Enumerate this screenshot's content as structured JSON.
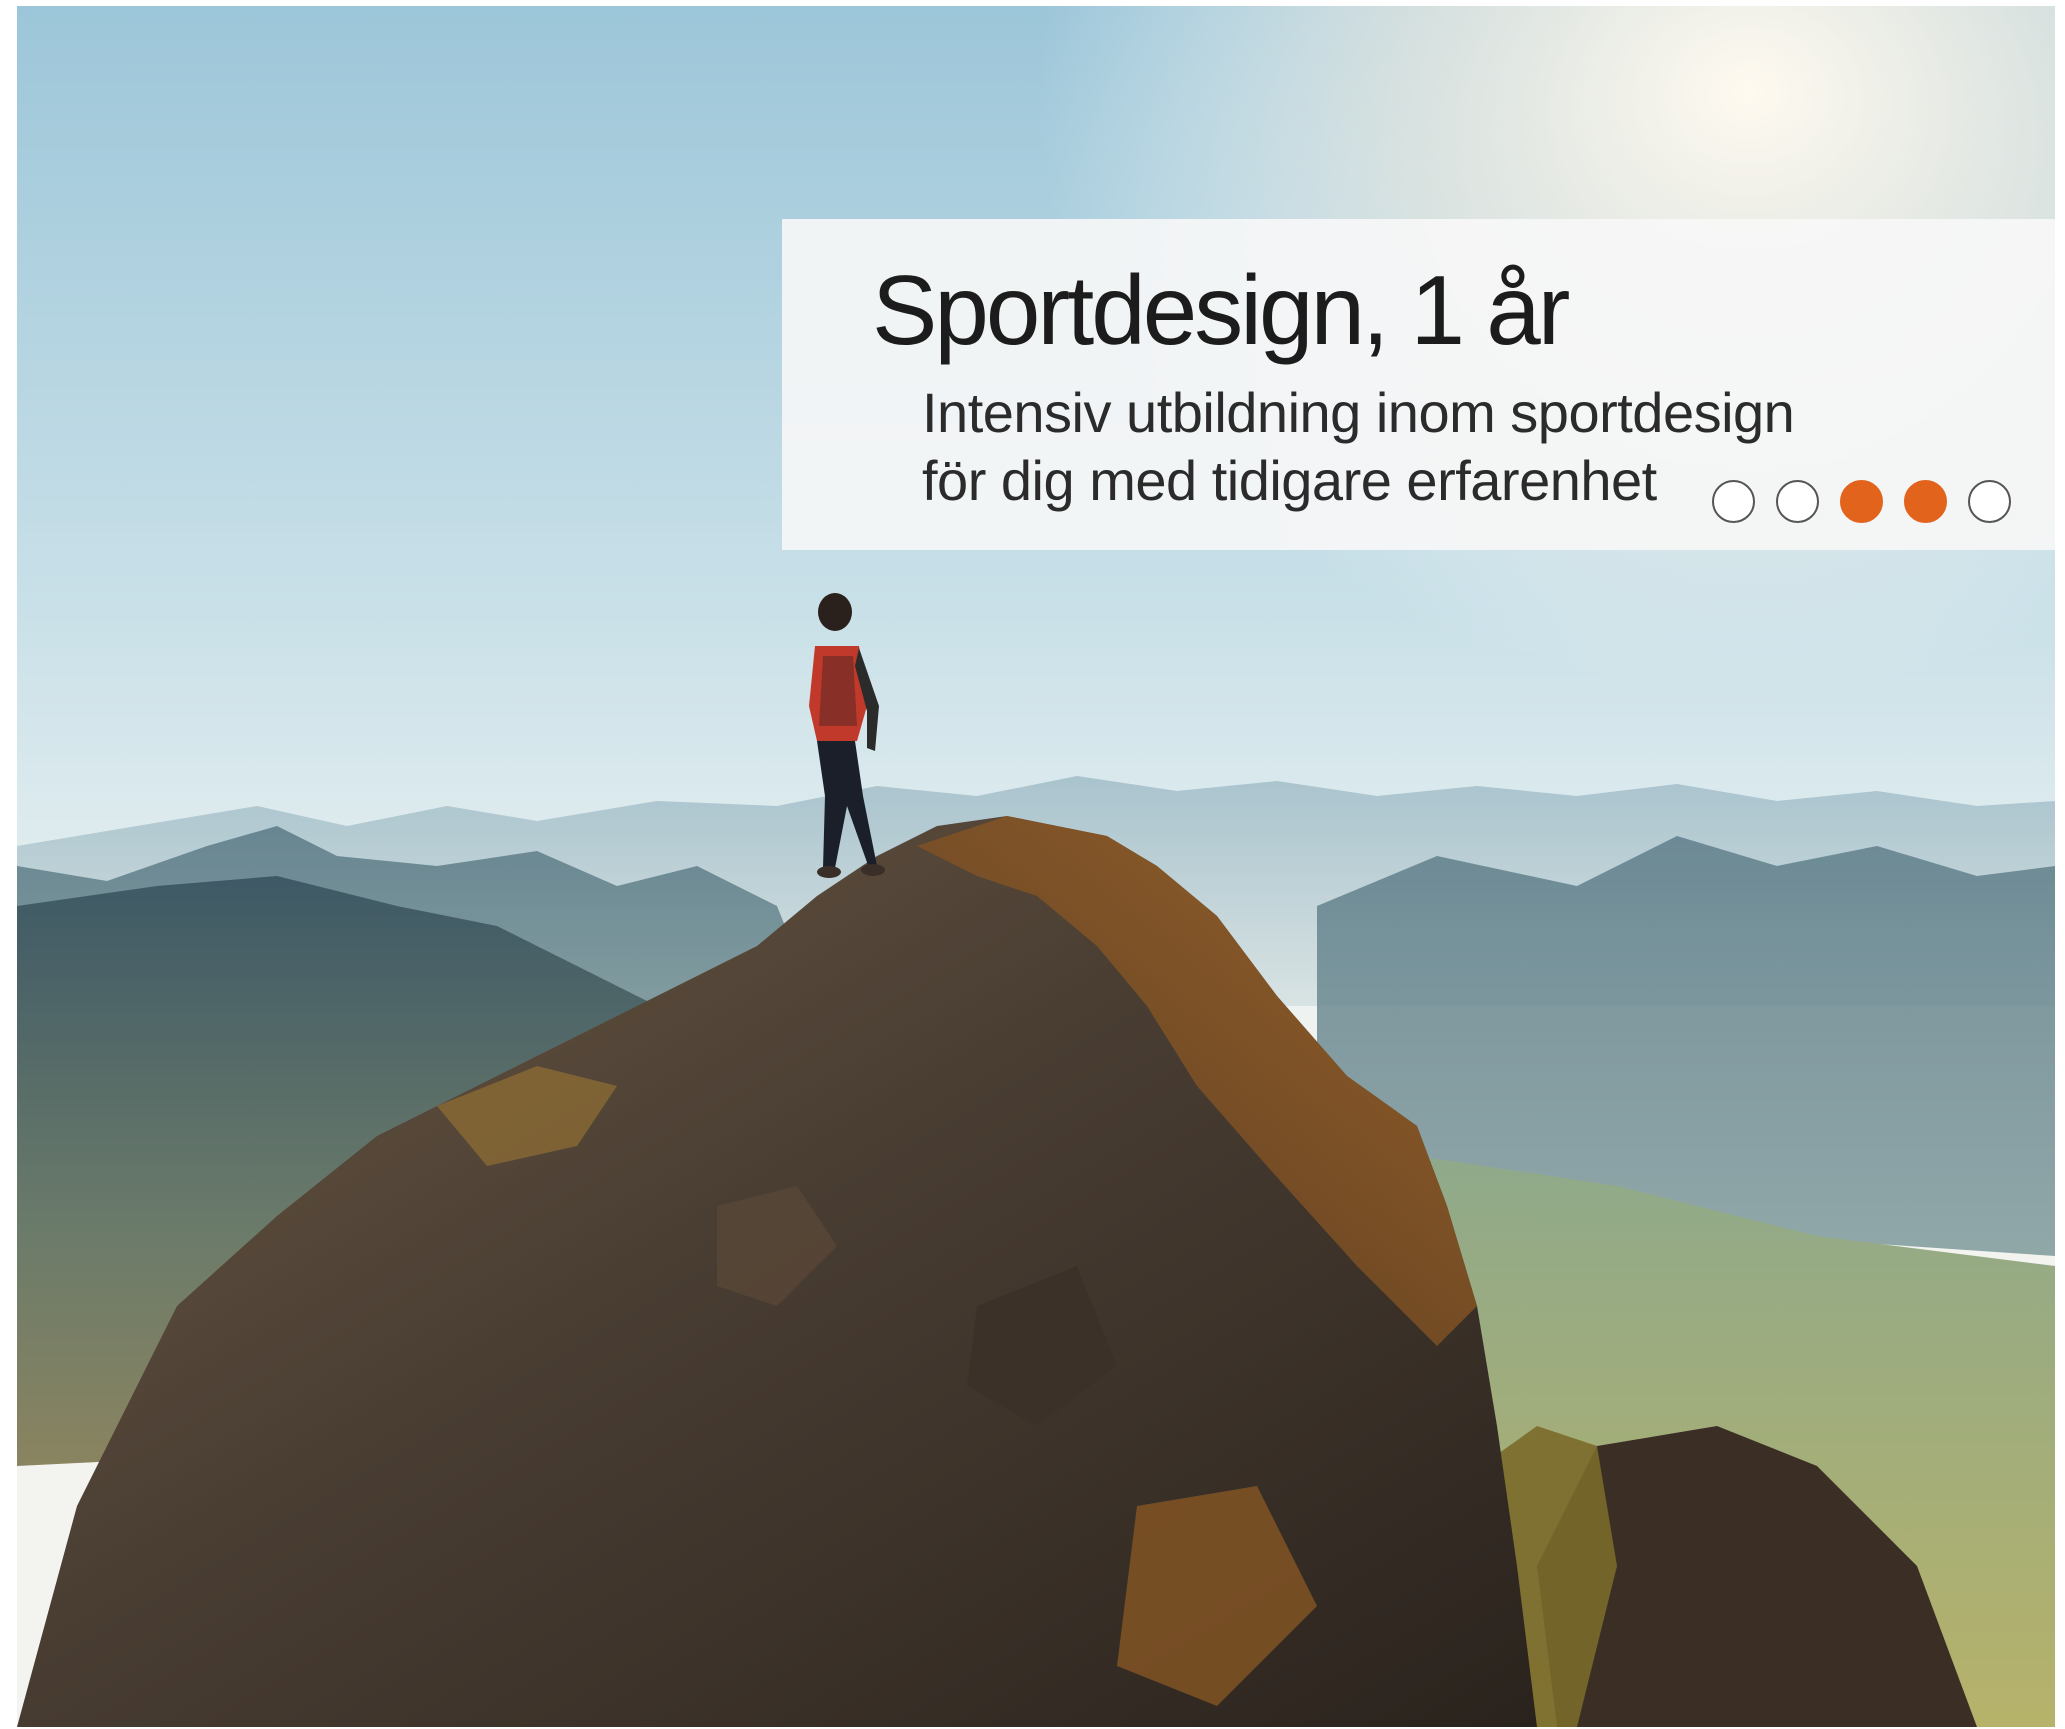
{
  "title": "Sportdesign, 1 år",
  "subtitle_lines": [
    "Intensiv utbildning inom sportdesign",
    "för dig med tidigare erfarenhet"
  ],
  "rating": {
    "filled": [
      false,
      false,
      true,
      true,
      false
    ],
    "filled_color": "#e2631c",
    "empty_color": "#ffffff"
  },
  "photo": {
    "icon": "mountain-summit-hiker-photo"
  }
}
